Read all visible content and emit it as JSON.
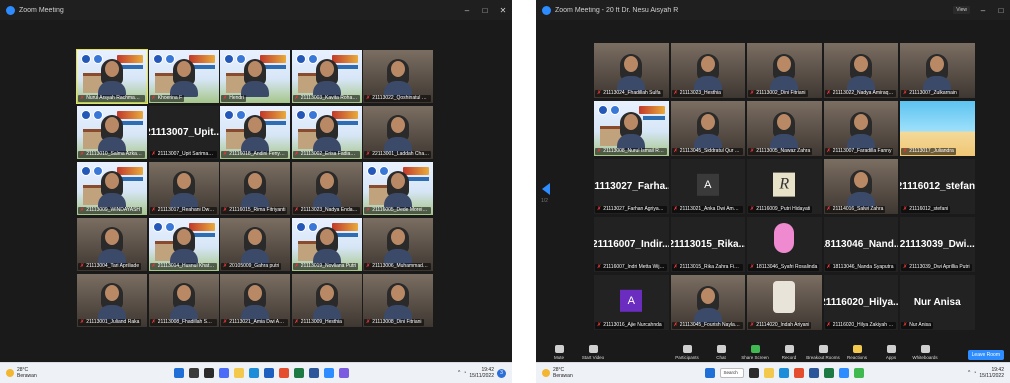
{
  "left_window": {
    "title": "Zoom Meeting",
    "controls": [
      "–",
      "□",
      "✕"
    ],
    "tiles": [
      {
        "name": "Nurul Arsyah Rachmawati",
        "type": "photo-bg",
        "active": true
      },
      {
        "name": "Khoerina F",
        "type": "photo-bg"
      },
      {
        "name": "Hendri",
        "type": "photo-bg"
      },
      {
        "name": "21113003_Kavita Rohaman",
        "type": "photo-bg"
      },
      {
        "name": "21113022_Qoshinatul Tha...",
        "type": "photo"
      },
      {
        "name": "21113010_Salma Azka M...",
        "type": "photo-bg"
      },
      {
        "name": "21113007_Upit Sarimanah",
        "type": "name",
        "big": "21113007_Upit..."
      },
      {
        "name": "21116018_Andini Fenya B...",
        "type": "photo-bg"
      },
      {
        "name": "21113002_Erisa Fadiah Pu...",
        "type": "photo-bg"
      },
      {
        "name": "22113001_Laddah Chaira...",
        "type": "photo"
      },
      {
        "name": "21113009_WINDAYASH",
        "type": "photo-bg"
      },
      {
        "name": "21113017_Reahani Dwana",
        "type": "photo"
      },
      {
        "name": "21116015_Rima Fitriyanti",
        "type": "photo"
      },
      {
        "name": "21113023_Nadya Endah ...",
        "type": "photo"
      },
      {
        "name": "21116005_Dede Moreikan...",
        "type": "photo-bg"
      },
      {
        "name": "21113004_Tari Apriliade",
        "type": "photo"
      },
      {
        "name": "21113014_Husnul Khatimi",
        "type": "photo-bg"
      },
      {
        "name": "20105009_Gahra putri",
        "type": "photo"
      },
      {
        "name": "21113019_Novliana Putri",
        "type": "photo-bg"
      },
      {
        "name": "21113006_Muhammad Fi...",
        "type": "photo"
      },
      {
        "name": "21113001_Juliand Raka",
        "type": "photo"
      },
      {
        "name": "21113008_Fhadillah Sulfa",
        "type": "photo"
      },
      {
        "name": "21113021_Amia Dwi Ama...",
        "type": "photo"
      },
      {
        "name": "21113009_Hesthia",
        "type": "photo"
      },
      {
        "name": "21113008_Dini Fitriani",
        "type": "photo"
      }
    ],
    "taskbar": {
      "temp": "28°C",
      "weather": "Berawan",
      "time": "19:42",
      "date": "15/11/2022",
      "notif": "3"
    }
  },
  "right_window": {
    "title": "Zoom Meeting - 20 ft Dr. Nesu Aisyah R",
    "view_button": "View",
    "page_indicator": "1/2",
    "tiles": [
      {
        "name": "21113024_Fhadillah Sulfa",
        "type": "photo"
      },
      {
        "name": "21113023_Hesthia",
        "type": "photo"
      },
      {
        "name": "21113002_Dini Fitriani",
        "type": "photo"
      },
      {
        "name": "21113022_Nadya Amiraqdi Siregar",
        "type": "photo"
      },
      {
        "name": "21113007_Zulkarnain",
        "type": "photo"
      },
      {
        "name": "21113008_Nurul Ismail Rahmi",
        "type": "photo-bg"
      },
      {
        "name": "21113045_Siddratul Qur Aini Siba",
        "type": "photo"
      },
      {
        "name": "21113005_Nawaz Zahra",
        "type": "photo"
      },
      {
        "name": "21113007_Faradilla Fanny",
        "type": "photo"
      },
      {
        "name": "21113017_Juliandra",
        "type": "beach"
      },
      {
        "name": "21113027_Farhan Agriyandi",
        "type": "name",
        "big": "21113027_Farha..."
      },
      {
        "name": "21113021_Anka Dwi Amalia",
        "type": "avatar-letter",
        "letter": "A",
        "grey": true
      },
      {
        "name": "21116009_Putri Hidayati",
        "type": "letter-r",
        "letter": "R"
      },
      {
        "name": "21114016_Salwi Zahra",
        "type": "photo"
      },
      {
        "name": "21116012_stefani",
        "type": "name",
        "big": "21116012_stefani"
      },
      {
        "name": "21116007_Indri Metta Wijayanti",
        "type": "name",
        "big": "21116007_Indir..."
      },
      {
        "name": "21113015_Rika Zahra Fianti",
        "type": "name",
        "big": "21113015_Rika..."
      },
      {
        "name": "18113046_Syafri Rosalinda",
        "type": "cartoon"
      },
      {
        "name": "18113046_Nanda Syaputra",
        "type": "name",
        "big": "18113046_Nand..."
      },
      {
        "name": "21113039_Dwi Aprillia Putri",
        "type": "name",
        "big": "21113039_Dwi..."
      },
      {
        "name": "21113016_Ajie Nurcahnda",
        "type": "avatar-letter",
        "letter": "A"
      },
      {
        "name": "21113045_Fourish Nayla Viola",
        "type": "photo"
      },
      {
        "name": "21114020_Indah Ariyani",
        "type": "ghost"
      },
      {
        "name": "21116020_Hilya Zakiyah Ridha",
        "type": "name",
        "big": "21116020_Hilya..."
      },
      {
        "name": "Nur Anisa",
        "type": "name",
        "big": "Nur Anisa"
      }
    ],
    "controls": [
      "Mute",
      "Start Video",
      "Participants",
      "Chat",
      "Share Screen",
      "Record",
      "Breakout Rooms",
      "Reactions",
      "Apps",
      "Whiteboards"
    ],
    "leave_label": "Leave Room",
    "taskbar": {
      "temp": "28°C",
      "weather": "Berawan",
      "search": "Search",
      "time": "19:42",
      "date": "15/11/2022"
    }
  },
  "colors": {
    "zoom_blue": "#2d8cff",
    "mic_muted": "#e23636",
    "active_speaker": "#e8e24a"
  }
}
